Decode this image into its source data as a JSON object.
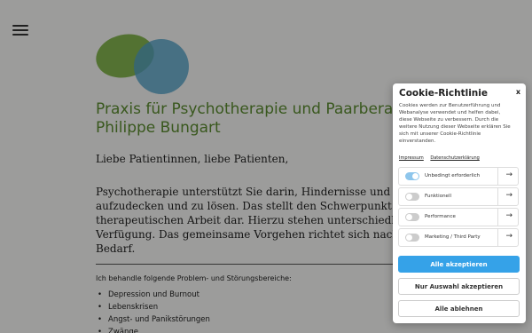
{
  "header": {
    "menu_icon": "hamburger-menu-icon"
  },
  "logo": {
    "icon": "overlapping-circles-logo",
    "colors": {
      "green": "#6fa632",
      "blue": "#4f9dc4"
    }
  },
  "main": {
    "title_line1": "Praxis für Psychotherapie und Paarberatung",
    "title_line2": "Philippe Bungart",
    "greeting": "Liebe Patientinnen, liebe Patienten,",
    "intro_lines": [
      "Psychotherapie unterstützt Sie darin, Hindernisse und Blockaden",
      "aufzudecken und zu lösen. Das stellt den Schwerpunkt meiner",
      "therapeutischen Arbeit dar. Hierzu stehen unterschiedliche Meth",
      "Verfügung. Das gemeinsame Vorgehen richtet sich nach Ihrem ko",
      "Bedarf."
    ],
    "areas_title": "Ich behandle folgende Problem- und Störungsbereiche:",
    "areas": [
      "Depression und Burnout",
      "Lebenskrisen",
      "Angst- und Panikstörungen",
      "Zwänge"
    ]
  },
  "cookie": {
    "title": "Cookie-Richtlinie",
    "close": "x",
    "text_lines": [
      "Cookies werden zur Benutzerführung und",
      "Webanalyse verwendet und helfen dabei,",
      "diese Webseite zu verbessern. Durch die",
      "weitere Nutzung dieser Webseite erklären Sie",
      "sich mit unserer Cookie-Richtlinie",
      "einverstanden."
    ],
    "links": {
      "imprint": "Impressum",
      "privacy": "Datenschutzerklärung"
    },
    "options": [
      {
        "label": "Unbedingt erforderlich",
        "enabled": true
      },
      {
        "label": "Funktionell",
        "enabled": false
      },
      {
        "label": "Performance",
        "enabled": false
      },
      {
        "label": "Marketing / Third Party",
        "enabled": false
      }
    ],
    "arrow": "→",
    "buttons": {
      "accept_all": "Alle akzeptieren",
      "accept_selection": "Nur Auswahl akzeptieren",
      "reject_all": "Alle ablehnen"
    },
    "accent_color": "#35a2e8"
  }
}
